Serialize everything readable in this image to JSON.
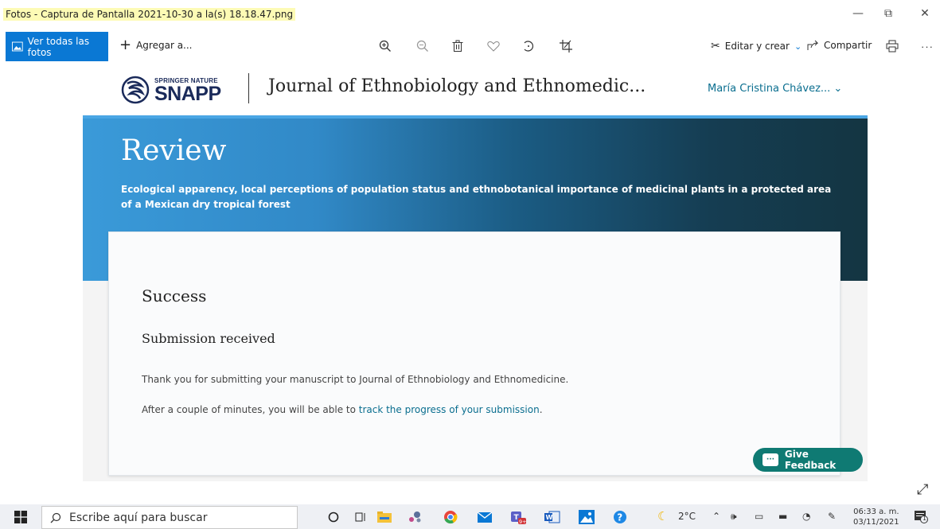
{
  "window": {
    "title": "Fotos - Captura de Pantalla 2021-10-30 a la(s) 18.18.47.png",
    "minimize": "—",
    "restore": "⧉",
    "close": "✕"
  },
  "photos_toolbar": {
    "all_photos_label": "Ver todas las fotos",
    "add_label": "Agregar a...",
    "edit_label": "Editar y crear",
    "share_label": "Compartir",
    "icons": [
      "zoom-in-icon",
      "zoom-out-icon",
      "delete-icon",
      "heart-icon",
      "rotate-icon",
      "crop-icon",
      "print-icon",
      "more-icon"
    ]
  },
  "site": {
    "logo_small": "SPRINGER NATURE",
    "logo_big": "SNAPP",
    "journal_title": "Journal of Ethnobiology and Ethnomedic...",
    "user_name": "María Cristina Chávez... ⌄",
    "brand_color": "#1a2a5a",
    "link_color": "#0a6e8f"
  },
  "hero": {
    "title": "Review",
    "subtitle": "Ecological apparency, local perceptions of population status and ethnobotanical importance of medicinal plants in a protected area of a Mexican dry tropical forest"
  },
  "card": {
    "success_heading": "Success",
    "submission_heading": "Submission received",
    "thank_you": "Thank you for submitting your manuscript to Journal of Ethnobiology and Ethnomedicine.",
    "progress_prefix": "After a couple of minutes, you will be able to ",
    "progress_link": "track the progress of your submission",
    "progress_suffix": "."
  },
  "feedback": {
    "label": "Give Feedback",
    "color": "#0f7a73"
  },
  "taskbar": {
    "search_placeholder": "Escribe aquí para buscar",
    "weather": "2°C",
    "time": "06:33 a. m.",
    "date": "03/11/2021",
    "notification_count": "1"
  }
}
